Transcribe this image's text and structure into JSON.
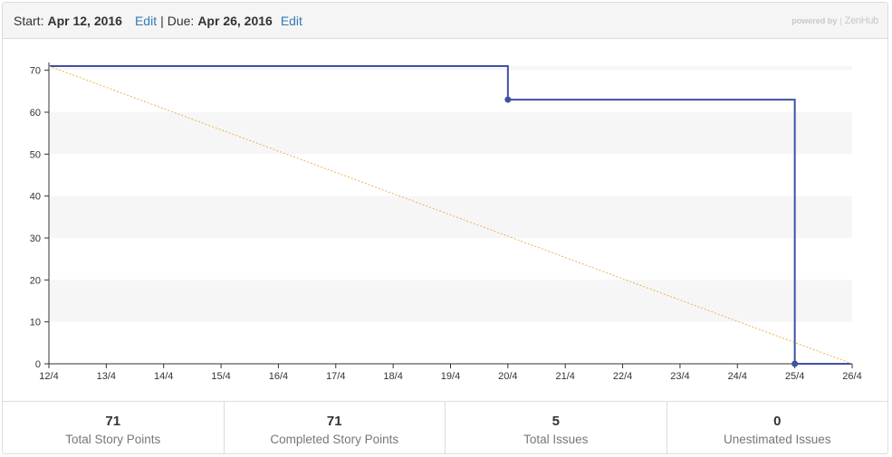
{
  "header": {
    "start_label": "Start:",
    "start_date": "Apr 12, 2016",
    "start_edit": "Edit",
    "separator": "|",
    "due_label": "Due:",
    "due_date": "Apr 26, 2016",
    "due_edit": "Edit",
    "powered_by": "powered by",
    "powered_pipe": "|",
    "brand": "ZenHub"
  },
  "chart_data": {
    "type": "line",
    "categories": [
      "12/4",
      "13/4",
      "14/4",
      "15/4",
      "16/4",
      "17/4",
      "18/4",
      "19/4",
      "20/4",
      "21/4",
      "22/4",
      "23/4",
      "24/4",
      "25/4",
      "26/4"
    ],
    "ylim": [
      0,
      71
    ],
    "yticks": [
      0,
      10,
      20,
      30,
      40,
      50,
      60,
      70
    ],
    "grid": "alternating horizontal bands",
    "series": [
      {
        "style": "step",
        "color": "#3f51a3",
        "points": [
          {
            "x": "12/4",
            "y": 71
          },
          {
            "x": "20/4",
            "y": 71
          },
          {
            "x": "20/4",
            "y": 63
          },
          {
            "x": "25/4",
            "y": 63
          },
          {
            "x": "25/4",
            "y": 0
          },
          {
            "x": "26/4",
            "y": 0
          }
        ],
        "markers": [
          {
            "x": "20/4",
            "y": 63
          },
          {
            "x": "25/4",
            "y": 0
          }
        ]
      },
      {
        "style": "dotted",
        "color": "#f0b050",
        "points": [
          {
            "x": "12/4",
            "y": 71
          },
          {
            "x": "26/4",
            "y": 0
          }
        ]
      }
    ]
  },
  "stats": [
    {
      "value": "71",
      "label": "Total Story Points"
    },
    {
      "value": "71",
      "label": "Completed Story Points"
    },
    {
      "value": "5",
      "label": "Total Issues"
    },
    {
      "value": "0",
      "label": "Unestimated Issues"
    }
  ]
}
